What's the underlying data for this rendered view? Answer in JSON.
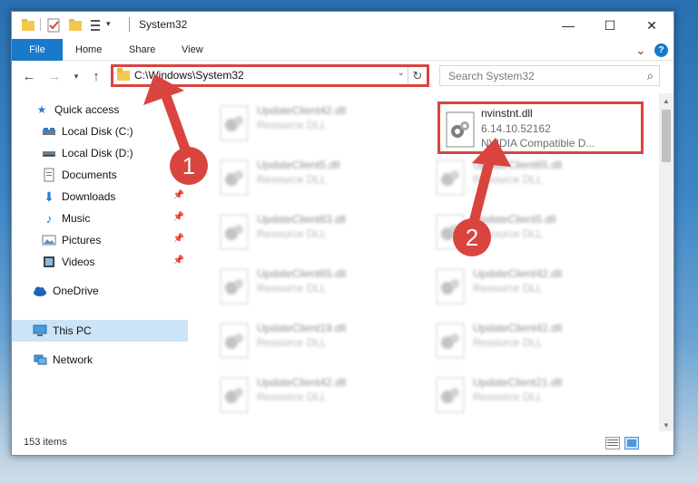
{
  "window": {
    "title": "System32",
    "controls": {
      "minimize": "—",
      "maximize": "☐",
      "close": "✕"
    }
  },
  "ribbon": {
    "tabs": [
      "File",
      "Home",
      "Share",
      "View"
    ],
    "help_icon": "?",
    "collapse_icon": "⌄"
  },
  "address": {
    "path": "C:\\Windows\\System32",
    "search_placeholder": "Search System32"
  },
  "nav_pane": {
    "items": [
      {
        "label": "Quick access",
        "icon": "star-icon"
      },
      {
        "label": "Local Disk (C:)",
        "icon": "drive-icon"
      },
      {
        "label": "Local Disk (D:)",
        "icon": "drive-icon"
      },
      {
        "label": "Documents",
        "icon": "documents-icon"
      },
      {
        "label": "Downloads",
        "icon": "download-icon",
        "pinned": true
      },
      {
        "label": "Music",
        "icon": "music-icon",
        "pinned": true
      },
      {
        "label": "Pictures",
        "icon": "pictures-icon",
        "pinned": true
      },
      {
        "label": "Videos",
        "icon": "videos-icon",
        "pinned": true
      },
      {
        "label": "OneDrive",
        "icon": "cloud-icon"
      },
      {
        "label": "This PC",
        "icon": "computer-icon",
        "selected": true
      },
      {
        "label": "Network",
        "icon": "network-icon"
      }
    ]
  },
  "files": {
    "highlighted": {
      "name": "nvinstnt.dll",
      "version": "6.14.10.52162",
      "description": "NVIDIA Compatible D..."
    },
    "left_column": [
      {
        "name": "UpdateClient42.dll",
        "type": "Resource DLL"
      },
      {
        "name": "UpdateClient5.dll",
        "type": "Resource DLL"
      },
      {
        "name": "UpdateClient63.dll",
        "type": "Resource DLL"
      },
      {
        "name": "UpdateClient65.dll",
        "type": "Resource DLL"
      },
      {
        "name": "UpdateClient19.dll",
        "type": "Resource DLL"
      },
      {
        "name": "UpdateClient42.dll",
        "type": "Resource DLL"
      }
    ],
    "right_column": [
      {
        "name": "UpdateClient65.dll",
        "type": "Resource DLL"
      },
      {
        "name": "UpdateClient5.dll",
        "type": "Resource DLL"
      },
      {
        "name": "UpdateClient42.dll",
        "type": "Resource DLL"
      },
      {
        "name": "UpdateClient42.dll",
        "type": "Resource DLL"
      },
      {
        "name": "UpdateClient21.dll",
        "type": "Resource DLL"
      }
    ]
  },
  "status": {
    "item_count": "153 items"
  },
  "annotations": {
    "step1": "1",
    "step2": "2",
    "color": "#d9443f"
  },
  "colors": {
    "file_tab": "#1979ca",
    "selected_nav": "#cce4f7",
    "annotation_red": "#d9443f"
  }
}
